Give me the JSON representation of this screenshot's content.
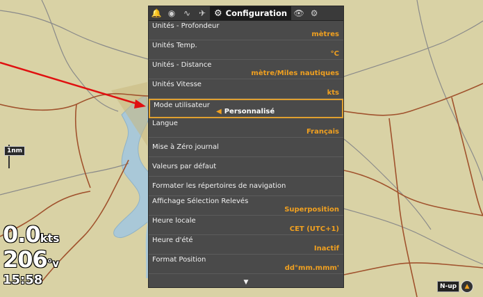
{
  "tabs": {
    "icons": [
      "bell-icon",
      "compass-icon",
      "sonar-icon",
      "boat-icon"
    ],
    "active_label": "Configuration",
    "right_icons": [
      "eye-icon",
      "accessories-icon"
    ]
  },
  "menu": {
    "items": [
      {
        "label": "Unités - Profondeur",
        "value": "mètres"
      },
      {
        "label": "Unités Temp.",
        "value": "°C"
      },
      {
        "label": "Unités - Distance",
        "value": "mètre/Miles nautiques"
      },
      {
        "label": "Unités Vitesse",
        "value": "kts"
      },
      {
        "label": "Mode utilisateur",
        "value": "Personnalisé",
        "selected": true
      },
      {
        "label": "Langue",
        "value": "Français"
      },
      {
        "label": "Mise à Zéro journal",
        "value": ""
      },
      {
        "label": "Valeurs par défaut",
        "value": ""
      },
      {
        "label": "Formater les répertoires de navigation",
        "value": ""
      },
      {
        "label": "Affichage Sélection Relevés",
        "value": "Superposition"
      },
      {
        "label": "Heure locale",
        "value": "CET (UTC+1)"
      },
      {
        "label": "Heure d'été",
        "value": "Inactif"
      },
      {
        "label": "Format Position",
        "value": "dd°mm.mmm'"
      }
    ]
  },
  "hud": {
    "speed_value": "0.0",
    "speed_unit": "kts",
    "heading_value": "206",
    "heading_unit": "°v",
    "time": "15:58"
  },
  "map": {
    "scale": "1nm",
    "orientation": "N-up"
  },
  "colors": {
    "accent": "#f0a020",
    "menu_bg": "#4a4a4a",
    "land": "#d9d2a5",
    "water": "#a9c8d8",
    "road": "#a0522d"
  }
}
